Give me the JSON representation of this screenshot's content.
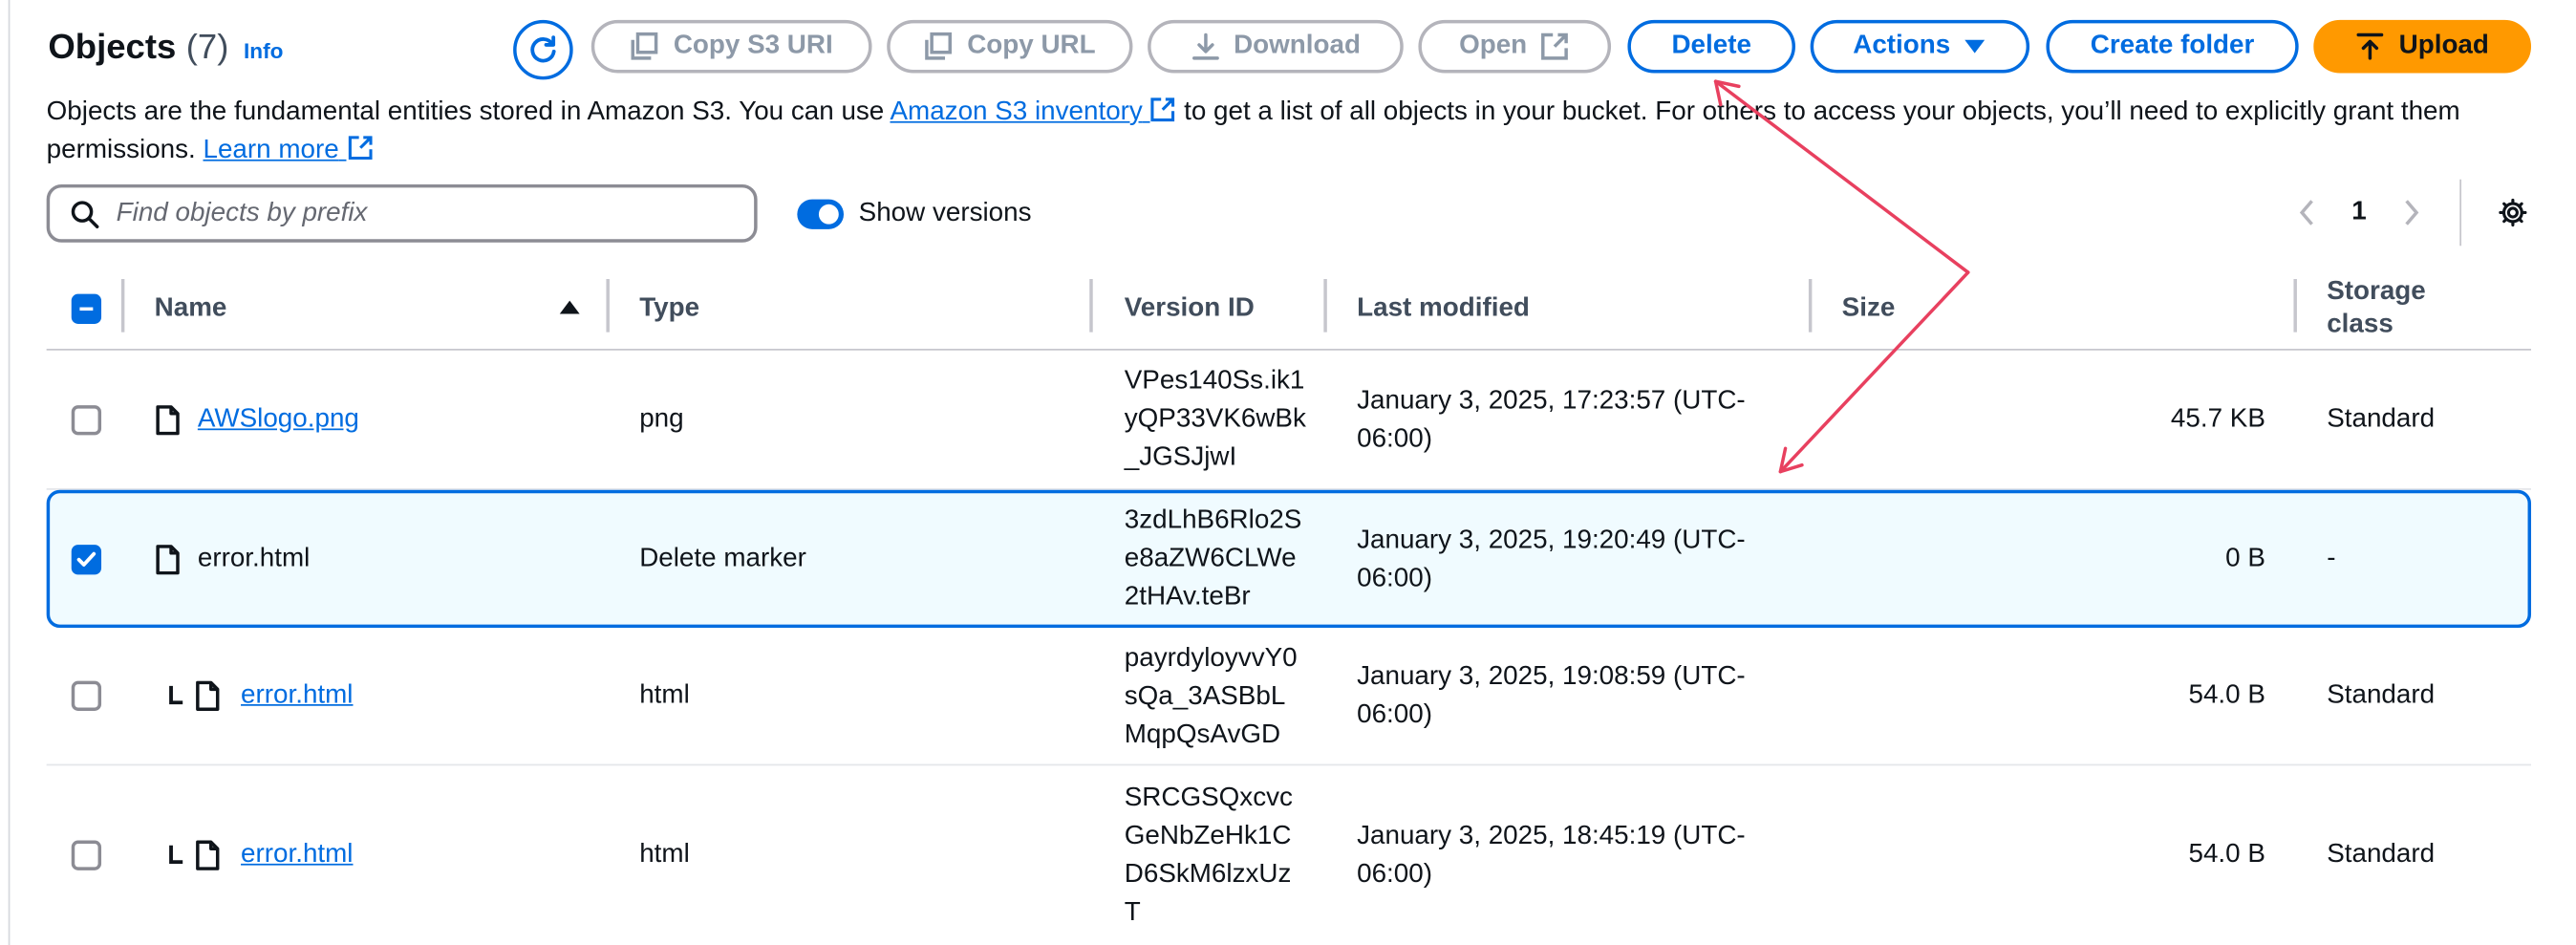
{
  "header": {
    "title": "Objects",
    "count": "(7)",
    "info": "Info",
    "buttons": {
      "copy_s3_uri": "Copy S3 URI",
      "copy_url": "Copy URL",
      "download": "Download",
      "open": "Open",
      "delete": "Delete",
      "actions": "Actions",
      "create_folder": "Create folder",
      "upload": "Upload"
    }
  },
  "description": {
    "part1": "Objects are the fundamental entities stored in Amazon S3. You can use ",
    "inventory_link": "Amazon S3 inventory",
    "part2": " to get a list of all objects in your bucket. For others to access your objects, you’ll need to explicitly grant them permissions. ",
    "learn_more": "Learn more"
  },
  "search": {
    "placeholder": "Find objects by prefix"
  },
  "versions_toggle": {
    "label": "Show versions",
    "on": true
  },
  "pagination": {
    "page": "1"
  },
  "table": {
    "columns": {
      "name": "Name",
      "type": "Type",
      "version_id": "Version ID",
      "last_modified": "Last modified",
      "size": "Size",
      "storage_class": "Storage class"
    },
    "rows": [
      {
        "name": "AWSlogo.png",
        "type": "png",
        "version_id": "VPes140Ss.ik1yQP33VK6wBk_JGSJjwI",
        "last_modified": "January 3, 2025, 17:23:57 (UTC-06:00)",
        "size": "45.7 KB",
        "storage_class": "Standard"
      },
      {
        "name": "error.html",
        "type": "Delete marker",
        "version_id": "3zdLhB6Rlo2Se8aZW6CLWe2tHAv.teBr",
        "last_modified": "January 3, 2025, 19:20:49 (UTC-06:00)",
        "size": "0 B",
        "storage_class": "-"
      },
      {
        "name": "error.html",
        "type": "html",
        "version_id": "payrdyloyvvY0sQa_3ASBbLMqpQsAvGD",
        "last_modified": "January 3, 2025, 19:08:59 (UTC-06:00)",
        "size": "54.0 B",
        "storage_class": "Standard"
      },
      {
        "name": "error.html",
        "type": "html",
        "version_id": "SRCGSQxcvcGeNbZeHk1CD6SkM6lzxUzT",
        "last_modified": "January 3, 2025, 18:45:19 (UTC-06:00)",
        "size": "54.0 B",
        "storage_class": "Standard"
      }
    ]
  },
  "colors": {
    "accent": "#006ce0",
    "upload": "#ff9900",
    "annotation": "#e8405f",
    "selected_row_bg": "#f0fbff"
  }
}
